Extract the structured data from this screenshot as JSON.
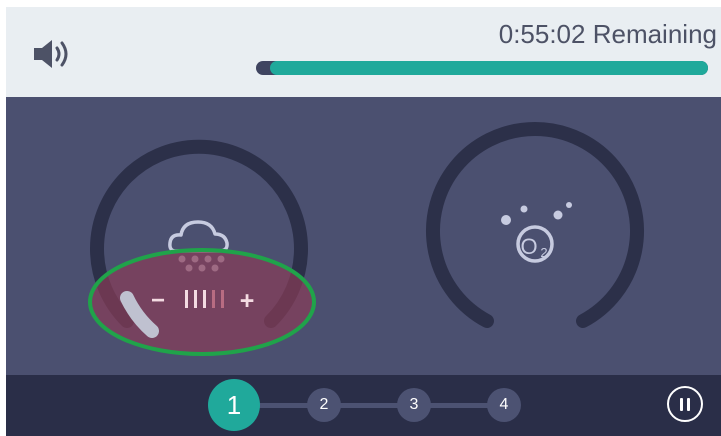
{
  "header": {
    "volume_icon": "speaker-volume-icon",
    "remaining_text": "0:55:02 Remaining",
    "progress_fraction": 0.97
  },
  "gauges": {
    "moisture": {
      "icon": "cloud-rain-icon",
      "minus_label": "−",
      "plus_label": "+",
      "level_bars_total": 5,
      "level_bars_active": 3,
      "highlighted": true
    },
    "oxygen": {
      "icon": "o2-bubbles-icon",
      "icon_text": "O",
      "icon_subscript": "2"
    }
  },
  "footer": {
    "steps": [
      "1",
      "2",
      "3",
      "4"
    ],
    "active_step": "1",
    "pause_icon": "pause-icon"
  },
  "colors": {
    "accent": "#20a99b",
    "panel": "#4b5070",
    "footer": "#2a2e48",
    "highlight_ring": "#20a34a",
    "highlight_fill": "#8a3d57"
  }
}
